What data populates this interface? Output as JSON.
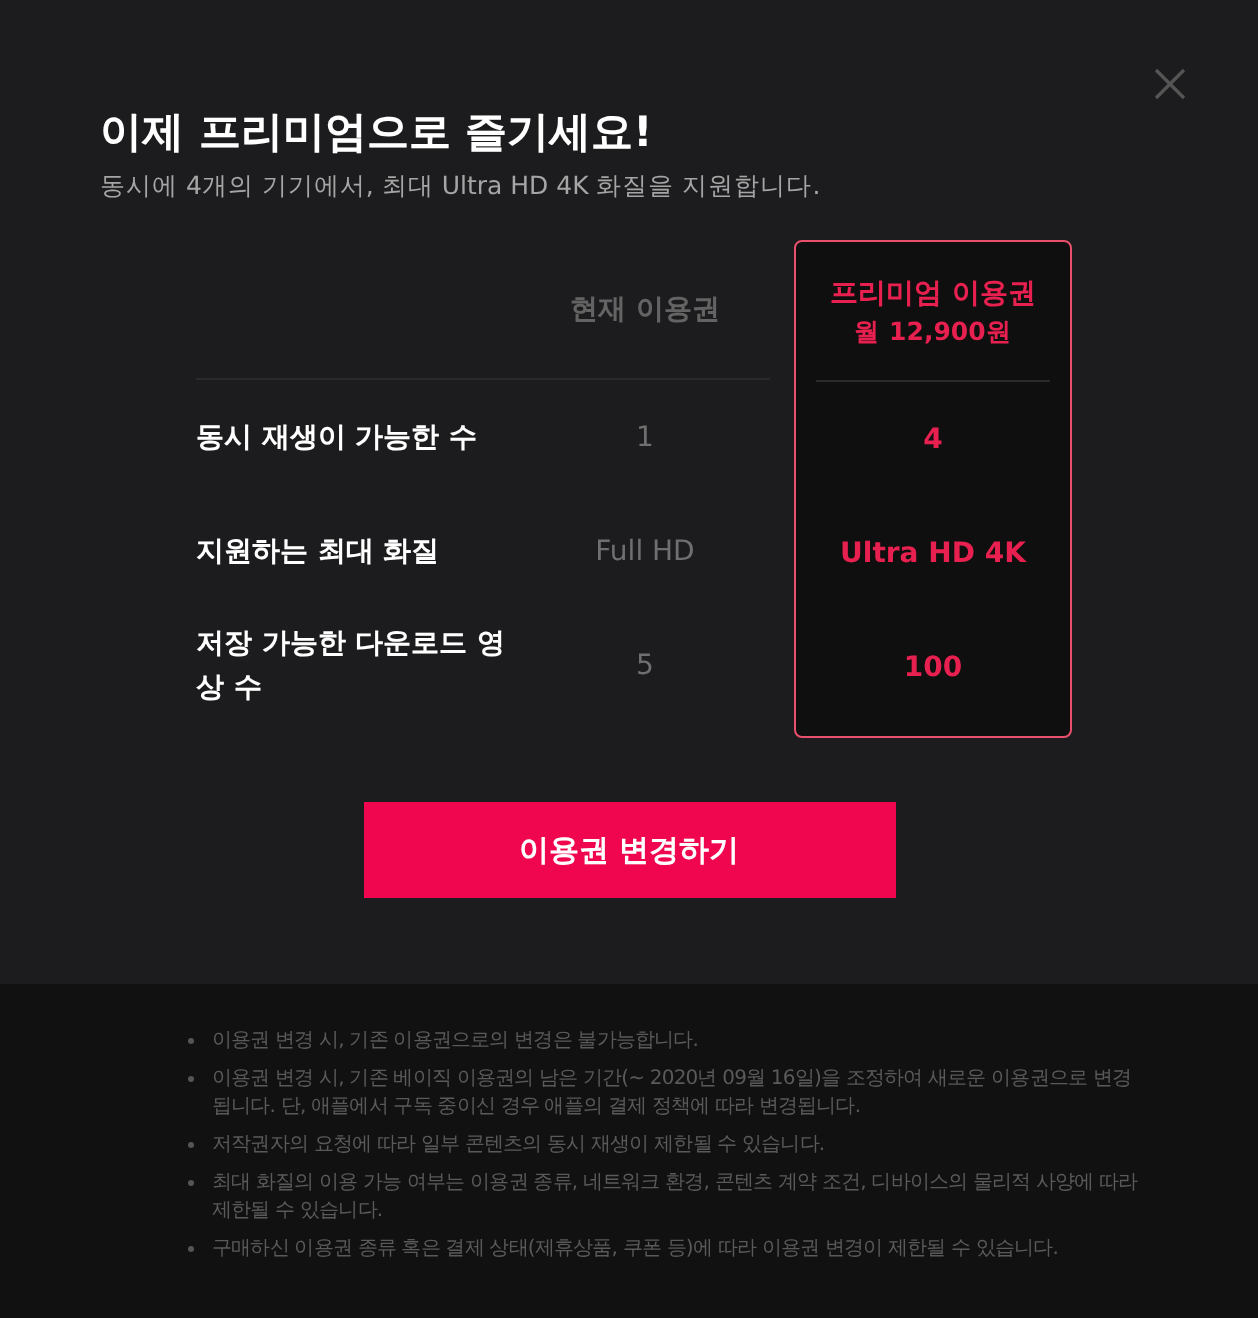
{
  "title": "이제 프리미엄으로 즐기세요!",
  "subtitle": "동시에 4개의 기기에서, 최대 Ultra HD 4K 화질을 지원합니다.",
  "features": [
    "동시 재생이 가능한 수",
    "지원하는 최대 화질",
    "저장 가능한 다운로드 영상 수"
  ],
  "plans": [
    {
      "name": "현재 이용권",
      "selected": false,
      "values": [
        "1",
        "Full HD",
        "5"
      ]
    },
    {
      "name": "프리미엄 이용권",
      "price": "월 12,900원",
      "selected": true,
      "values": [
        "4",
        "Ultra HD 4K",
        "100"
      ]
    }
  ],
  "button": "이용권 변경하기",
  "notes": [
    "이용권 변경 시, 기존 이용권으로의 변경은 불가능합니다.",
    "이용권 변경 시, 기존 베이직 이용권의 남은 기간(~ 2020년 09월 16일)을 조정하여 새로운 이용권으로 변경됩니다. 단, 애플에서 구독 중이신 경우 애플의 결제 정책에 따라 변경됩니다.",
    "저작권자의 요청에 따라 일부 콘텐츠의 동시 재생이 제한될 수 있습니다.",
    "최대 화질의 이용 가능 여부는 이용권 종류, 네트워크 환경, 콘텐츠 계약 조건, 디바이스의 물리적 사양에 따라 제한될 수 있습니다.",
    "구매하신 이용권 종류 혹은 결제 상태(제휴상품, 쿠폰 등)에 따라 이용권 변경이 제한될 수 있습니다."
  ]
}
